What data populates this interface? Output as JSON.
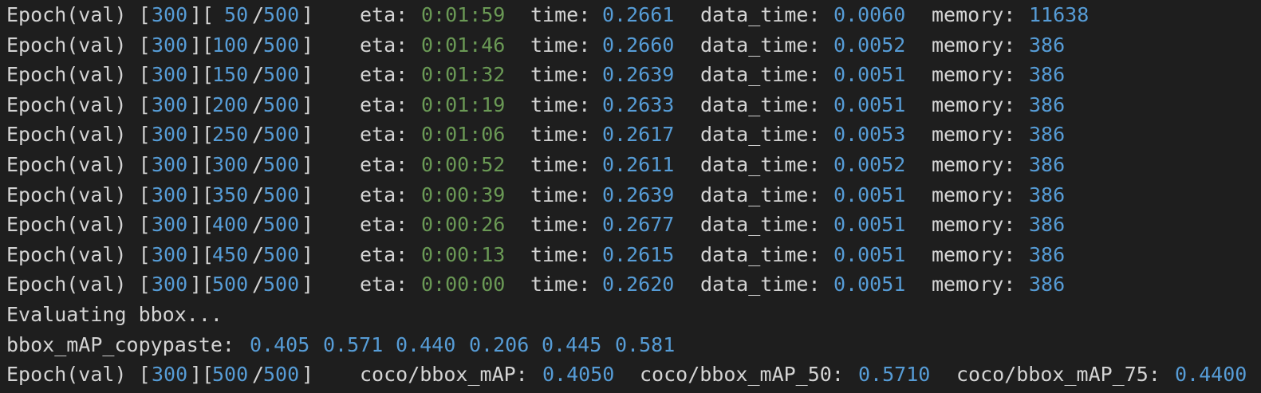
{
  "colors": {
    "background": "#1e1e1e",
    "text": "#d4d4d4",
    "number": "#569cd6",
    "eta": "#6a9955"
  },
  "log": {
    "epoch_prefix": "Epoch(val) [",
    "rows": [
      {
        "epoch": "300",
        "iter": " 50",
        "total": "500",
        "eta": "0:01:59",
        "time": "0.2661",
        "data_time": "0.0060",
        "memory": "11638"
      },
      {
        "epoch": "300",
        "iter": "100",
        "total": "500",
        "eta": "0:01:46",
        "time": "0.2660",
        "data_time": "0.0052",
        "memory": "386"
      },
      {
        "epoch": "300",
        "iter": "150",
        "total": "500",
        "eta": "0:01:32",
        "time": "0.2639",
        "data_time": "0.0051",
        "memory": "386"
      },
      {
        "epoch": "300",
        "iter": "200",
        "total": "500",
        "eta": "0:01:19",
        "time": "0.2633",
        "data_time": "0.0051",
        "memory": "386"
      },
      {
        "epoch": "300",
        "iter": "250",
        "total": "500",
        "eta": "0:01:06",
        "time": "0.2617",
        "data_time": "0.0053",
        "memory": "386"
      },
      {
        "epoch": "300",
        "iter": "300",
        "total": "500",
        "eta": "0:00:52",
        "time": "0.2611",
        "data_time": "0.0052",
        "memory": "386"
      },
      {
        "epoch": "300",
        "iter": "350",
        "total": "500",
        "eta": "0:00:39",
        "time": "0.2639",
        "data_time": "0.0051",
        "memory": "386"
      },
      {
        "epoch": "300",
        "iter": "400",
        "total": "500",
        "eta": "0:00:26",
        "time": "0.2677",
        "data_time": "0.0051",
        "memory": "386"
      },
      {
        "epoch": "300",
        "iter": "450",
        "total": "500",
        "eta": "0:00:13",
        "time": "0.2615",
        "data_time": "0.0051",
        "memory": "386"
      },
      {
        "epoch": "300",
        "iter": "500",
        "total": "500",
        "eta": "0:00:00",
        "time": "0.2620",
        "data_time": "0.0051",
        "memory": "386"
      }
    ],
    "labels": {
      "eta": "eta:",
      "time": "time:",
      "data_time": "data_time:",
      "memory": "memory:"
    },
    "evaluating": "Evaluating bbox...",
    "copypaste": {
      "label": "bbox_mAP_copypaste:",
      "values": [
        "0.405",
        "0.571",
        "0.440",
        "0.206",
        "0.445",
        "0.581"
      ]
    },
    "final": {
      "epoch": "300",
      "iter": "500",
      "total": "500",
      "map_label": "coco/bbox_mAP:",
      "map": "0.4050",
      "map50_label": "coco/bbox_mAP_50:",
      "map50": "0.5710",
      "map75_label": "coco/bbox_mAP_75:",
      "map75": "0.4400"
    }
  }
}
